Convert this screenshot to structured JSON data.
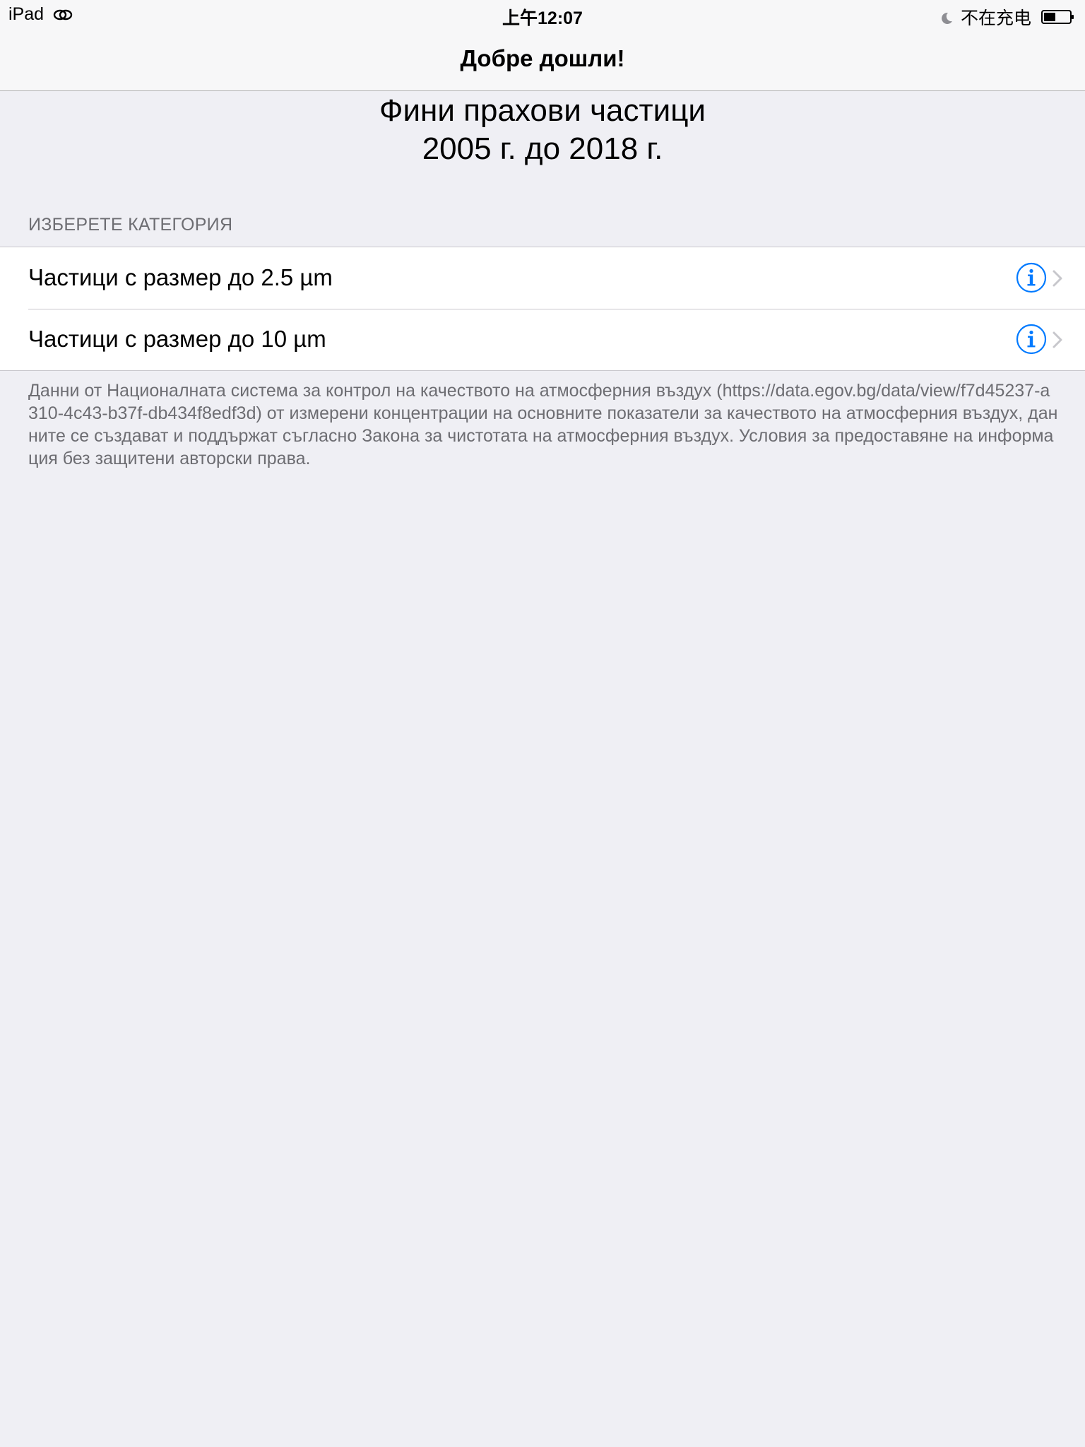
{
  "status_bar": {
    "device": "iPad",
    "time": "上午12:07",
    "charging_status": "不在充电"
  },
  "nav": {
    "title": "Добре дошли!"
  },
  "header": {
    "title_line1": "Фини прахови частици",
    "title_line2": "2005 г. до 2018 г."
  },
  "section": {
    "header": "ИЗБЕРЕТЕ КАТЕГОРИЯ",
    "items": [
      {
        "label": "Частици с размер до 2.5 µm",
        "icon": "info-icon"
      },
      {
        "label": "Частици с размер до 10 µm",
        "icon": "info-icon"
      }
    ],
    "footer": "Данни от Националната система за контрол на качеството на атмосферния въздух (https://data.egov.bg/data/view/f7d45237-a310-4c43-b37f-db434f8edf3d) от измерени концентрации на основните показатели за качеството на атмосферния въздух, данните се създават и поддържат съгласно Закона за чистотата на атмосферния въздух. Условия за предоставяне на информация без защитени авторски права."
  },
  "colors": {
    "accent": "#007aff",
    "background": "#efeff4",
    "secondary_text": "#6d6d72"
  }
}
